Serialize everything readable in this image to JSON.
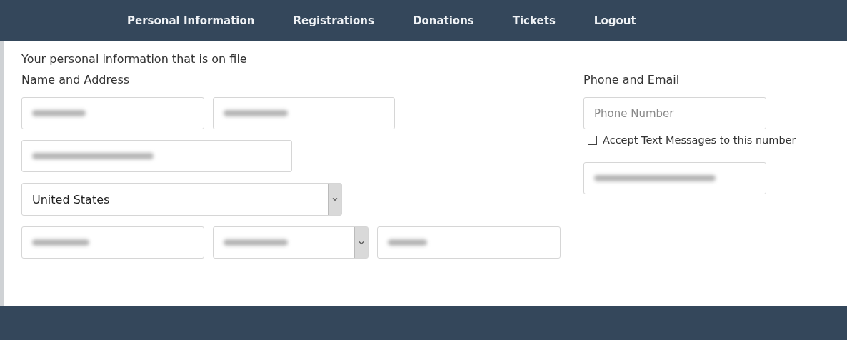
{
  "nav": {
    "items": [
      "Personal Information",
      "Registrations",
      "Donations",
      "Tickets",
      "Logout"
    ]
  },
  "intro": "Your personal information that is on file",
  "name_address": {
    "heading": "Name and Address",
    "rows": [
      [
        {
          "kind": "blurred"
        },
        {
          "kind": "blurred"
        }
      ],
      [
        {
          "kind": "blurred"
        }
      ],
      [
        {
          "kind": "select",
          "value": "United States"
        }
      ],
      [
        {
          "kind": "blurred"
        },
        {
          "kind": "blurred-select"
        },
        {
          "kind": "blurred"
        }
      ]
    ]
  },
  "phone_email": {
    "heading": "Phone and Email",
    "phone": {
      "placeholder": "Phone Number"
    },
    "sms": {
      "label": "Accept Text Messages to this number",
      "checked": false
    },
    "email": {
      "kind": "blurred"
    }
  }
}
